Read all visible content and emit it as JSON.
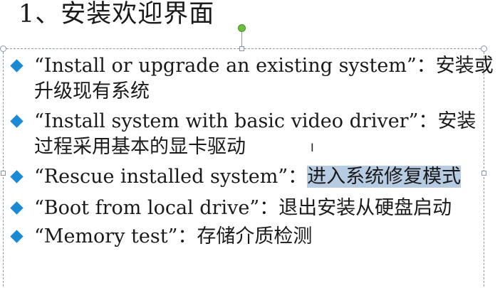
{
  "slide": {
    "title": "1、安装欢迎界面"
  },
  "bullets": [
    {
      "line1": "“Install or upgrade an existing system”：安装或",
      "line2": "升级现有系统"
    },
    {
      "line1": "“Install system with basic video driver”：安装",
      "line2": "过程采用基本的显卡驱动"
    },
    {
      "prefix": "“Rescue installed system”：",
      "highlighted": "进入系统修复模式"
    },
    {
      "line1": "“Boot from local drive”：退出安装从硬盘启动"
    },
    {
      "line1": "“Memory test”：存储介质检测"
    }
  ],
  "colors": {
    "bullet": "#1a8ad6",
    "selection_highlight": "#b7cbe2",
    "rotate_handle": "#6cbf3c"
  },
  "icons": {
    "bullet": "diamond-bullet-icon",
    "cursor": "text-cursor-icon"
  }
}
